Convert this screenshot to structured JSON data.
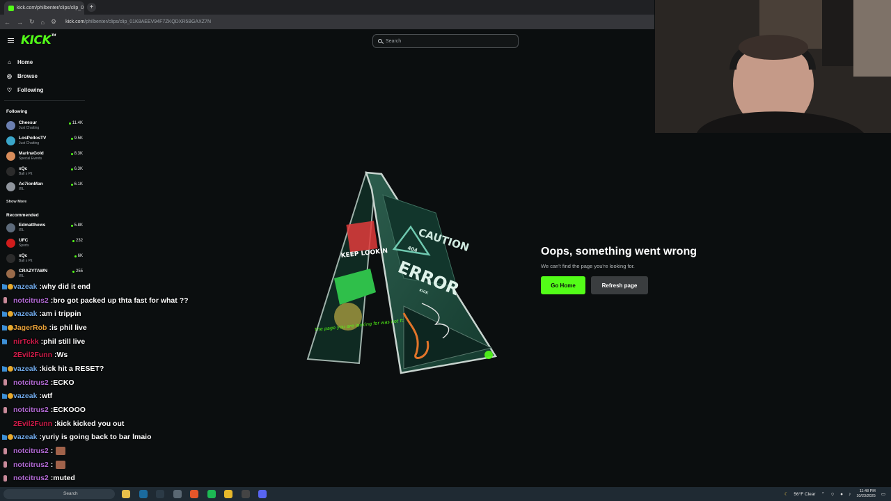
{
  "browser": {
    "tab_title": "kick.com/philbenter/clips/clip_0",
    "tab_close": "×",
    "new_tab": "+",
    "url_host": "kick.com",
    "url_path": "/philbenter/clips/clip_01K8AEEV94F7ZKQDXR5BGAXZ7N"
  },
  "header": {
    "logo": "KICK",
    "logo_tm": "TM",
    "search_placeholder": "Search"
  },
  "sidebar": {
    "nav": [
      {
        "label": "Home",
        "icon": "home-icon"
      },
      {
        "label": "Browse",
        "icon": "compass-icon"
      },
      {
        "label": "Following",
        "icon": "heart-icon"
      }
    ],
    "following_title": "Following",
    "following": [
      {
        "name": "Cheesur",
        "category": "Just Chatting",
        "viewers": "11.4K",
        "color": "#6b7fb0"
      },
      {
        "name": "LosPollosTV",
        "category": "Just Chatting",
        "viewers": "9.5K",
        "color": "#3aa6c9"
      },
      {
        "name": "MarinaGold",
        "category": "Special Events",
        "viewers": "8.3K",
        "color": "#d88c5a"
      },
      {
        "name": "xQc",
        "category": "Ball x Pit",
        "viewers": "6.3K",
        "color": "#2b2b2b"
      },
      {
        "name": "Ac7ionMan",
        "category": "IRL",
        "viewers": "6.1K",
        "color": "#8f949c"
      }
    ],
    "show_more": "Show More",
    "recommended_title": "Recommended",
    "recommended": [
      {
        "name": "Edmatthews",
        "category": "IRL",
        "viewers": "5.8K",
        "color": "#5d6a7a"
      },
      {
        "name": "UFC",
        "category": "Sports",
        "viewers": "232",
        "color": "#d01c1c"
      },
      {
        "name": "xQc",
        "category": "Ball x Pit",
        "viewers": "6K",
        "color": "#2b2b2b"
      },
      {
        "name": "CRAZYTAWN",
        "category": "IRL",
        "viewers": "255",
        "color": "#9a6b4a"
      }
    ]
  },
  "error": {
    "title": "Oops, something went wrong",
    "subtitle": "We can't find the page you're looking for.",
    "home_button": "Go Home",
    "refresh_button": "Refresh page",
    "sign_words": [
      "CAUTION",
      "404",
      "ERROR",
      "KEEP LOOKIN",
      "The page you are looking for was not found",
      "KICK"
    ]
  },
  "chat": [
    {
      "user": "vazeak",
      "color": "#6fa8e8",
      "badges": [
        "blue",
        "gold"
      ],
      "text": "why did it end"
    },
    {
      "user": "notcitrus2",
      "color": "#b36bd6",
      "badges": [
        "pink"
      ],
      "text": "bro got packed up thta fast for what ??"
    },
    {
      "user": "vazeak",
      "color": "#6fa8e8",
      "badges": [
        "blue",
        "gold"
      ],
      "text": "am i trippin"
    },
    {
      "user": "JagerRob",
      "color": "#e8a23a",
      "badges": [
        "blue",
        "gold"
      ],
      "text": "is phil live"
    },
    {
      "user": "nirTckk",
      "color": "#d01c4a",
      "badges": [
        "blue"
      ],
      "text": "phil still live"
    },
    {
      "user": "2Evil2Funn",
      "color": "#d01c4a",
      "badges": [],
      "text": "Ws"
    },
    {
      "user": "vazeak",
      "color": "#6fa8e8",
      "badges": [
        "blue",
        "gold"
      ],
      "text": "kick hit a RESET?"
    },
    {
      "user": "notcitrus2",
      "color": "#b36bd6",
      "badges": [
        "pink"
      ],
      "text": "ECKO"
    },
    {
      "user": "vazeak",
      "color": "#6fa8e8",
      "badges": [
        "blue",
        "gold"
      ],
      "text": "wtf"
    },
    {
      "user": "notcitrus2",
      "color": "#b36bd6",
      "badges": [
        "pink"
      ],
      "text": "ECKOOO"
    },
    {
      "user": "2Evil2Funn",
      "color": "#d01c4a",
      "badges": [],
      "text": "kick kicked you out"
    },
    {
      "user": "vazeak",
      "color": "#6fa8e8",
      "badges": [
        "blue",
        "gold"
      ],
      "text": "yuriy is going back to bar lmaio"
    },
    {
      "user": "notcitrus2",
      "color": "#b36bd6",
      "badges": [
        "pink"
      ],
      "text": "",
      "emote": true
    },
    {
      "user": "notcitrus2",
      "color": "#b36bd6",
      "badges": [
        "pink"
      ],
      "text": "",
      "emote": true
    },
    {
      "user": "notcitrus2",
      "color": "#b36bd6",
      "badges": [
        "pink"
      ],
      "text": "muted"
    },
    {
      "user": "notcitrus2",
      "color": "#b36bd6",
      "badges": [
        "pink"
      ],
      "text": "",
      "emote": true
    }
  ],
  "taskbar": {
    "search_label": "Search",
    "weather": "56°F  Clear",
    "time": "11:48 PM",
    "date": "10/23/2025",
    "icons": [
      {
        "name": "file-explorer-icon",
        "color": "#e8c04a"
      },
      {
        "name": "steam-icon",
        "color": "#1b6b9e"
      },
      {
        "name": "streamlabs-icon",
        "color": "#2b3a46"
      },
      {
        "name": "settings-icon",
        "color": "#5a6873"
      },
      {
        "name": "brave-icon",
        "color": "#e5562a"
      },
      {
        "name": "spotify-icon",
        "color": "#1db954"
      },
      {
        "name": "chrome-icon",
        "color": "#e7b82b"
      },
      {
        "name": "obs-icon",
        "color": "#444"
      },
      {
        "name": "discord-icon",
        "color": "#5865f2"
      }
    ]
  },
  "colors": {
    "accent": "#53fc18",
    "background": "#0b0e0f"
  }
}
